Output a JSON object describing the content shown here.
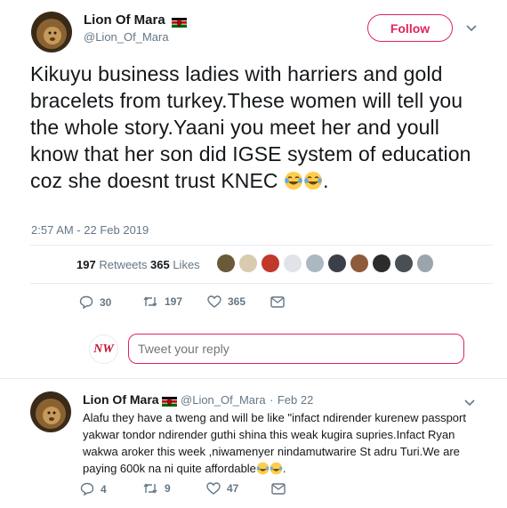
{
  "tweet": {
    "author_name": "Lion Of Mara",
    "author_handle": "@Lion_Of_Mara",
    "follow_label": "Follow",
    "text": "Kikuyu business ladies with harriers and gold bracelets from turkey.These women will tell you the whole story.Yaani you meet her and youll know that her son did IGSE system of education coz she doesnt trust KNEC",
    "text_suffix": ".",
    "emoji": "face-with-tears-of-joy",
    "timestamp": "2:57 AM - 22 Feb 2019",
    "retweets_count": "197",
    "retweets_label": "Retweets",
    "likes_count": "365",
    "likes_label": "Likes",
    "actions": {
      "reply_count": "30",
      "retweet_count": "197",
      "like_count": "365"
    }
  },
  "reply_composer": {
    "avatar_text": "NW",
    "placeholder": "Tweet your reply"
  },
  "reply": {
    "author_name": "Lion Of Mara",
    "author_handle": "@Lion_Of_Mara",
    "separator": "·",
    "date": "Feb 22",
    "text": "Alafu they have a tweng and will be like \"infact ndirender kurenew passport yakwar tondor ndirender guthi shina this weak kugira supries.Infact Ryan wakwa aroker this week ,niwamenyer nindamutwarire St adru Turi.We are paying 600k na ni quite affordable",
    "text_suffix": ".",
    "actions": {
      "reply_count": "4",
      "retweet_count": "9",
      "like_count": "47"
    }
  },
  "colors": {
    "accent": "#e0245e",
    "muted": "#657786",
    "text": "#14171a",
    "divider": "#e6ecf0"
  }
}
